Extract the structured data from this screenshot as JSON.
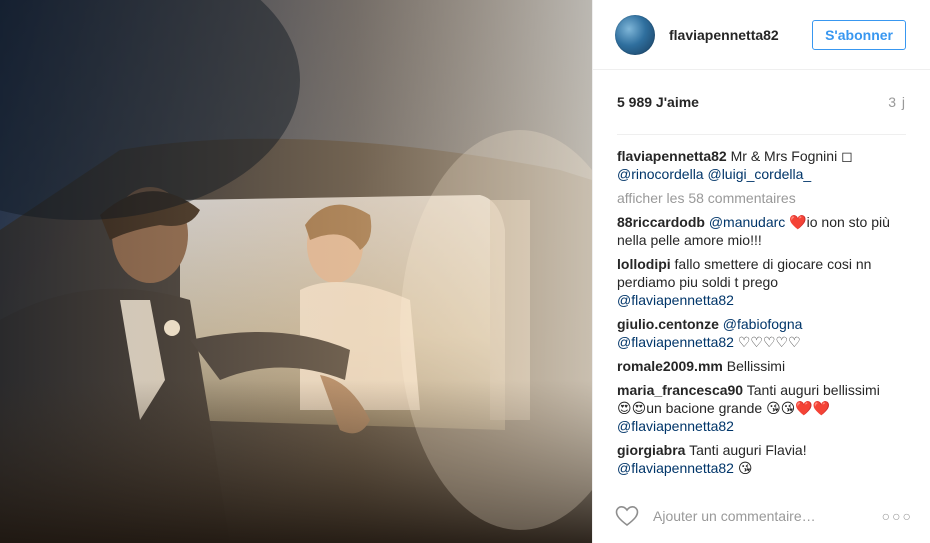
{
  "photo": {
    "alt": "Mr & Mrs Fognini"
  },
  "header": {
    "username": "flaviapennetta82",
    "follow_label": "S'abonner"
  },
  "stats": {
    "likes": "5 989 J'aime",
    "age": "3 j"
  },
  "caption": {
    "user": "flaviapennetta82",
    "text": "Mr & Mrs Fognini ◻",
    "mention1": "@rinocordella",
    "mention2": "@luigi_cordella_"
  },
  "view_all": "afficher les 58 commentaires",
  "comments": [
    {
      "user": "88riccardodb",
      "mention": "@manudarc",
      "text": "❤️io non sto più nella pelle amore mio!!!"
    },
    {
      "user": "lollodipi",
      "text": "fallo smettere di giocare cosi nn perdiamo piu soldi t prego",
      "mention": "@flaviapennetta82"
    },
    {
      "user": "giulio.centonze",
      "mention": "@fabiofogna",
      "mention2": "@flaviapennetta82",
      "text": "♡♡♡♡♡"
    },
    {
      "user": "romale2009.mm",
      "text": "Bellissimi"
    },
    {
      "user": "maria_francesca90",
      "text": "Tanti auguri bellissimi",
      "text2": "😍😍un bacione grande 😘😘❤️❤️",
      "mention": "@flaviapennetta82"
    },
    {
      "user": "giorgiabra",
      "text": "Tanti auguri Flavia!",
      "mention": "@flaviapennetta82",
      "text2": "😘"
    }
  ],
  "footer": {
    "placeholder": "Ajouter un commentaire…",
    "more": "○○○"
  },
  "colors": {
    "accent": "#3897f0",
    "mention": "#003569",
    "muted": "#999999",
    "text": "#262626"
  },
  "icons": [
    "heart-icon",
    "more-options-icon"
  ]
}
